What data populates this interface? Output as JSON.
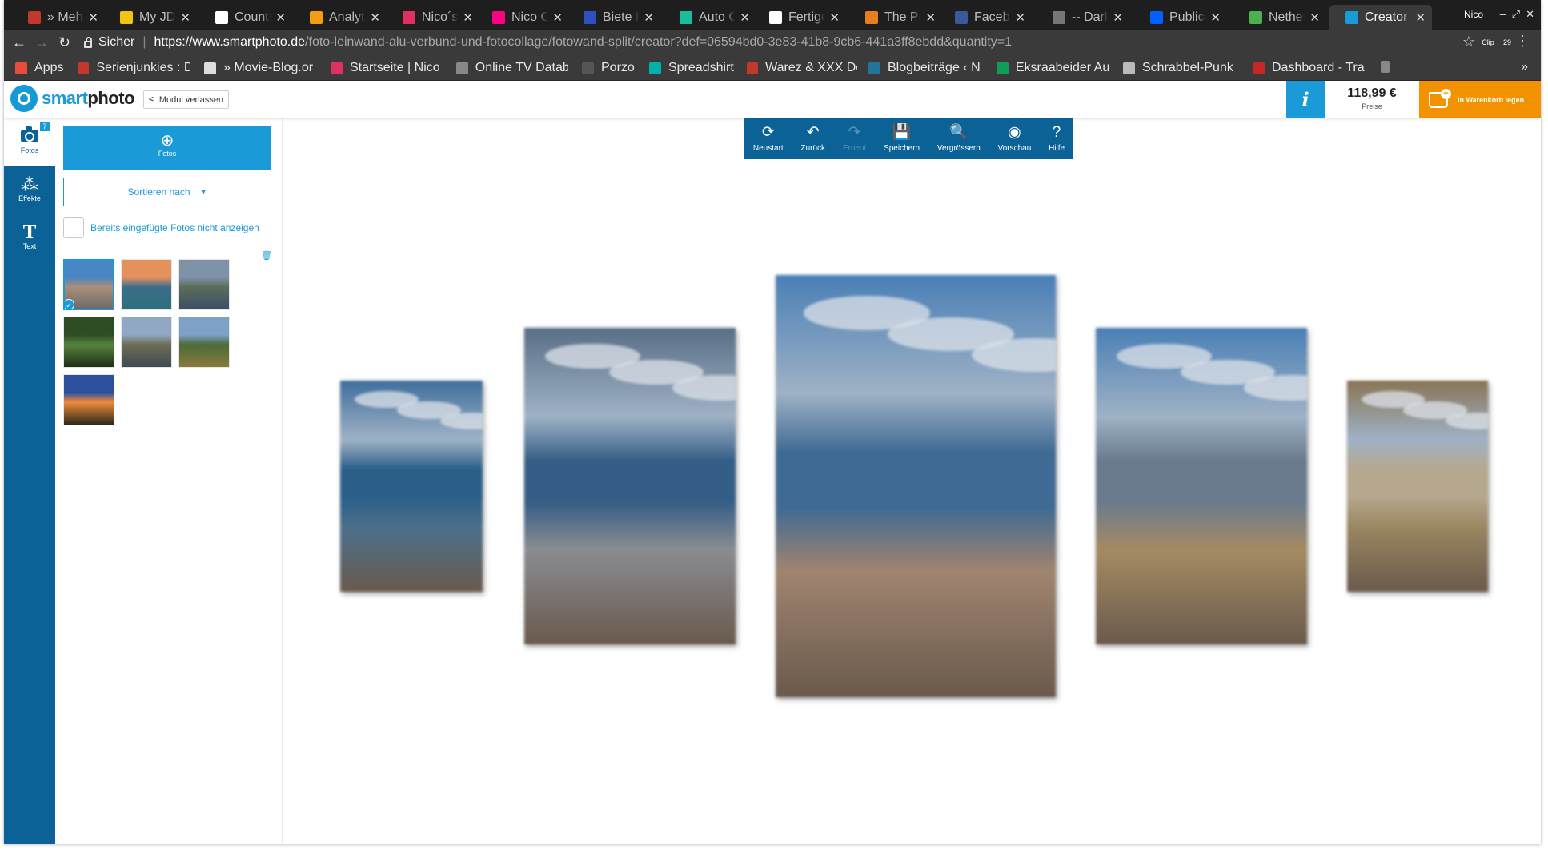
{
  "browser": {
    "tabs": [
      {
        "title": "» Mehr a",
        "color": "#c0392b"
      },
      {
        "title": "My JDow",
        "color": "#f1c40f"
      },
      {
        "title": "CountPe",
        "color": "#ffffff"
      },
      {
        "title": "Analytic",
        "color": "#f39c12"
      },
      {
        "title": "Nico´s A",
        "color": "#e03060"
      },
      {
        "title": "Nico Oe",
        "color": "#ff0084"
      },
      {
        "title": "Biete PC",
        "color": "#3050c0"
      },
      {
        "title": "Auto Or",
        "color": "#1abc9c"
      },
      {
        "title": "Fertige A",
        "color": "#ffffff"
      },
      {
        "title": "The Petr",
        "color": "#e67e22"
      },
      {
        "title": "Faceboo",
        "color": "#3b5998"
      },
      {
        "title": "-- Darkta",
        "color": "#777777"
      },
      {
        "title": "Public –",
        "color": "#0061fe"
      },
      {
        "title": "Nether –",
        "color": "#4caf50"
      },
      {
        "title": "Creator",
        "color": "#1a9ad7"
      }
    ],
    "user": "Nico",
    "window_controls": [
      "–",
      "⤢",
      "✕"
    ],
    "nav": {
      "back": "←",
      "forward": "→",
      "reload": "↻"
    },
    "secure_label": "Sicher",
    "url_host": "https://www.smartphoto.de",
    "url_path": "/foto-leinwand-alu-verbund-und-fotocollage/fotowand-split/creator?def=06594bd0-3e83-41b8-9cb6-441a3ff8ebdd&quantity=1",
    "extensions": [
      {
        "label": "Clip",
        "color": "#2e7d32"
      },
      {
        "label": "29",
        "color": "#d32f2f"
      }
    ],
    "bookmarks": [
      {
        "label": "Apps",
        "color": "#e74c3c"
      },
      {
        "label": "Serienjunkies : D",
        "color": "#c0392b"
      },
      {
        "label": "» Movie-Blog.or",
        "color": "#dddddd"
      },
      {
        "label": "Startseite | Nico",
        "color": "#e03060"
      },
      {
        "label": "Online TV Datab",
        "color": "#888888"
      },
      {
        "label": "Porzo",
        "color": "#555555"
      },
      {
        "label": "Spreadshirt",
        "color": "#00b2a9"
      },
      {
        "label": "Warez & XXX Do",
        "color": "#c0392b"
      },
      {
        "label": "Blogbeiträge ‹ N",
        "color": "#21759b"
      },
      {
        "label": "Eksraabeider Au",
        "color": "#0f9d58"
      },
      {
        "label": "Schrabbel-Punk",
        "color": "#bbbbbb"
      },
      {
        "label": "Dashboard - Tra",
        "color": "#c62828"
      },
      {
        "label": "",
        "color": "#888888"
      }
    ],
    "bookmarks_more": "»"
  },
  "app": {
    "logo_smart": "smart",
    "logo_photo": "photo",
    "leave_label": "Modul verlassen",
    "info_label": "i",
    "price": "118,99 €",
    "price_label": "Preise",
    "cart_label": "In Warenkorb legen"
  },
  "sidebar": {
    "items": [
      {
        "label": "Fotos",
        "badge": "7",
        "glyph": "camera"
      },
      {
        "label": "Effekte",
        "glyph": "⁂"
      },
      {
        "label": "Text",
        "glyph": "T"
      }
    ]
  },
  "photos_panel": {
    "add_label": "Fotos",
    "sort_label": "Sortieren nach",
    "hide_used_label": "Bereits eingefügte Fotos nicht anzeigen",
    "thumbnails": [
      {
        "name": "harbor-city",
        "selected": true,
        "colors": [
          "#4b86c4",
          "#a98e78",
          "#6f6b6c"
        ]
      },
      {
        "name": "colorful-shore",
        "selected": false,
        "colors": [
          "#e5915c",
          "#3b6d8c",
          "#2d6f7c"
        ]
      },
      {
        "name": "dusk-lake",
        "selected": false,
        "colors": [
          "#7e93a7",
          "#5c6d5a",
          "#3a4e66"
        ]
      },
      {
        "name": "forest-tunnel",
        "selected": false,
        "colors": [
          "#2d4d24",
          "#56843b",
          "#1e2e17"
        ]
      },
      {
        "name": "palace-reflection",
        "selected": false,
        "colors": [
          "#90a8c4",
          "#6d6c54",
          "#3f4b52"
        ]
      },
      {
        "name": "mountain-meadow",
        "selected": false,
        "colors": [
          "#7ea1c8",
          "#4a6b38",
          "#8a7a3c"
        ]
      },
      {
        "name": "sunset-sky",
        "selected": false,
        "colors": [
          "#2c4f9e",
          "#f08a3a",
          "#2a2a18"
        ]
      }
    ]
  },
  "editor": {
    "toolbar": [
      {
        "label": "Neustart",
        "glyph": "⟳",
        "enabled": true
      },
      {
        "label": "Zurück",
        "glyph": "↶",
        "enabled": true
      },
      {
        "label": "Erneut",
        "glyph": "↷",
        "enabled": false
      },
      {
        "label": "Speichern",
        "glyph": "💾",
        "enabled": true
      },
      {
        "label": "Vergrössern",
        "glyph": "🔍",
        "enabled": true
      },
      {
        "label": "Vorschau",
        "glyph": "◉",
        "enabled": true
      },
      {
        "label": "Hilfe",
        "glyph": "?",
        "enabled": true
      }
    ],
    "split_panels": [
      {
        "name": "panel-1"
      },
      {
        "name": "panel-2"
      },
      {
        "name": "panel-3"
      },
      {
        "name": "panel-4"
      },
      {
        "name": "panel-5"
      }
    ]
  }
}
